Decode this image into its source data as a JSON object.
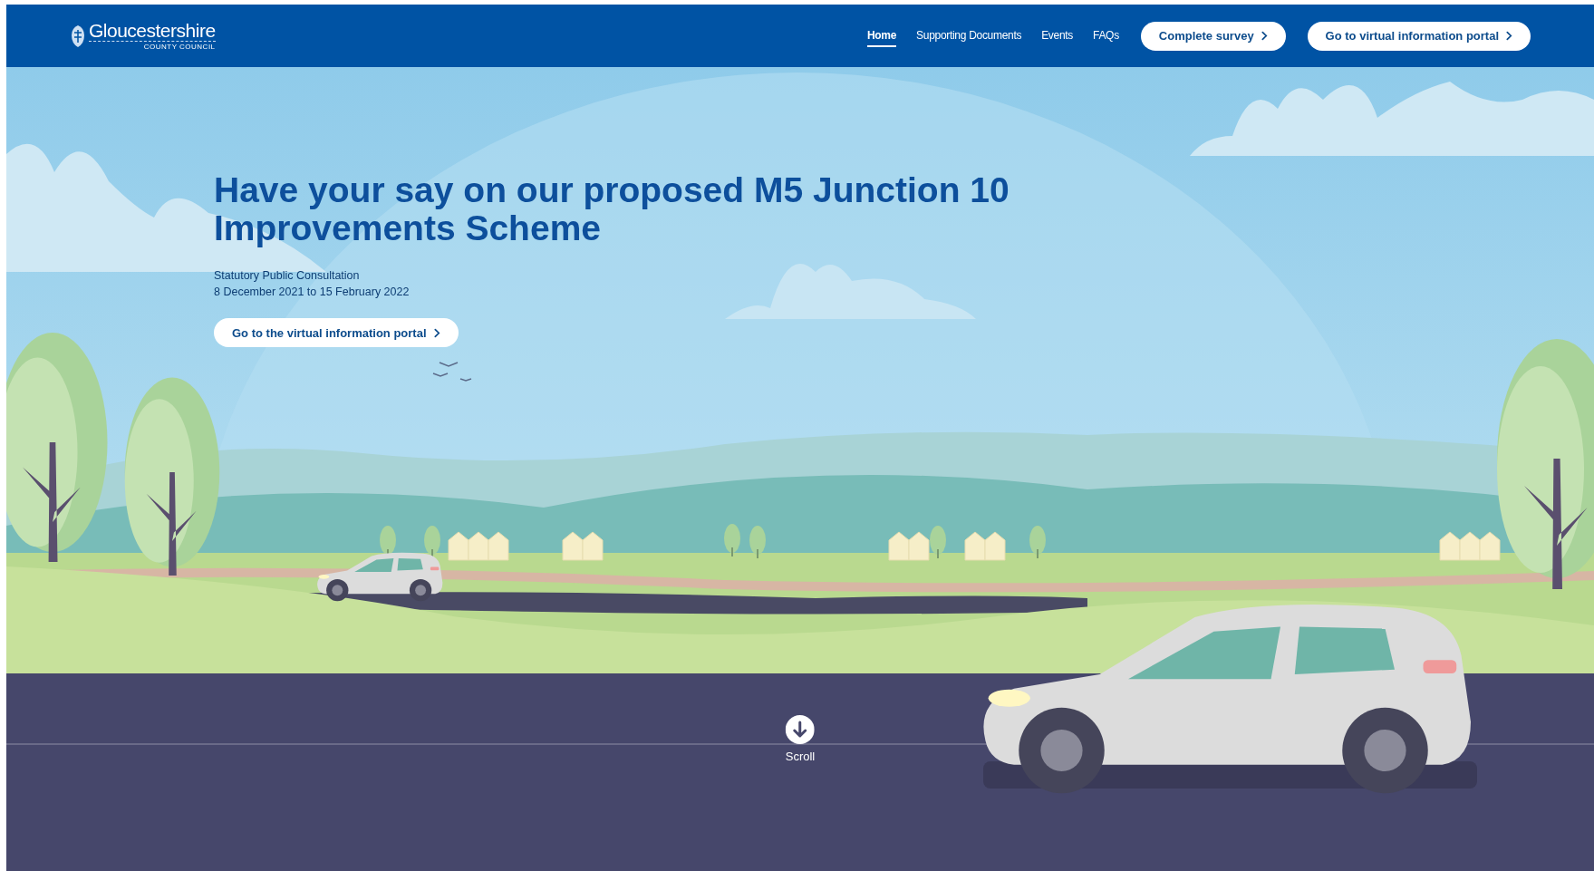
{
  "header": {
    "logo": {
      "name": "Gloucestershire",
      "subtitle": "COUNTY COUNCIL"
    },
    "nav": [
      {
        "label": "Home",
        "selected": true
      },
      {
        "label": "Supporting Documents",
        "selected": false
      },
      {
        "label": "Events",
        "selected": false
      },
      {
        "label": "FAQs",
        "selected": false
      }
    ],
    "buttons": [
      {
        "label": "Complete survey"
      },
      {
        "label": "Go to virtual information portal"
      }
    ]
  },
  "hero": {
    "heading": "Have your say on our proposed M5 Junction 10 Improvements Scheme",
    "subheading": "Statutory Public Consultation",
    "dates": "8 December 2021 to 15 February 2022",
    "button": "Go to the virtual information portal"
  },
  "scroll": {
    "label": "Scroll"
  }
}
